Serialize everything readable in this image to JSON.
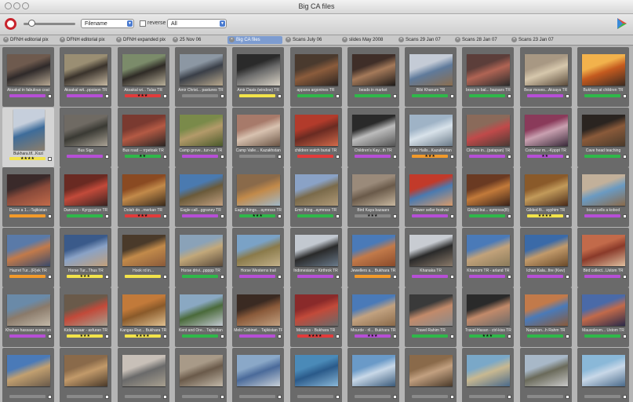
{
  "window": {
    "title": "Big CA files"
  },
  "toolbar": {
    "sort_value": "Filename",
    "reverse_label": "reverse",
    "filter_value": "All"
  },
  "tabs": [
    {
      "label": "DFNH editorial pix"
    },
    {
      "label": "DFNH editorial pix"
    },
    {
      "label": "DFNH expanded pix"
    },
    {
      "label": "25 Nov 06"
    },
    {
      "label": "Big CA files"
    },
    {
      "label": "Scans July 06"
    },
    {
      "label": "slides May 2008"
    },
    {
      "label": "Scans 29 Jan 07"
    },
    {
      "label": "Scans 28 Jan 07"
    },
    {
      "label": "Scans 23 Jan 07"
    }
  ],
  "active_tab": 4,
  "label_colors": {
    "purple": "#b64fd6",
    "green": "#2fb84a",
    "red": "#e23b3b",
    "yellow": "#f2e34a",
    "orange": "#f39a2a",
    "blue": "#4a7bd0",
    "gray": "#8a8a8a"
  },
  "rows": [
    [
      {
        "cap": "Aksakal in fabulous coat",
        "label": "purple",
        "stars": "",
        "img": [
          "#6e5a4e",
          "#2f2a2a",
          "#b7a893"
        ]
      },
      {
        "cap": "Aksakal wit...ppoison TR",
        "label": "purple",
        "stars": "",
        "img": [
          "#9a8e73",
          "#3a332c",
          "#c7b9a2"
        ]
      },
      {
        "cap": "Aksakal wi... Talas TR",
        "label": "red",
        "stars": "★★★",
        "img": [
          "#7b8b6a",
          "#2f2b26",
          "#b9b09a"
        ]
      },
      {
        "cap": "Amir Christ... pastures TR",
        "label": "gray",
        "stars": "",
        "img": [
          "#8c97a3",
          "#3a3f48",
          "#b8a88d"
        ]
      },
      {
        "cap": "Amir Dasis (window) TR",
        "label": "yellow",
        "stars": "",
        "img": [
          "#2a2a2a",
          "#6b6b6b",
          "#d7d1c4"
        ]
      },
      {
        "cap": "appana argonines TR",
        "label": "green",
        "stars": "",
        "img": [
          "#4a3a2e",
          "#8b5c3c",
          "#2c2420"
        ]
      },
      {
        "cap": "beads in market",
        "label": "green",
        "stars": "",
        "img": [
          "#3f2e28",
          "#a57a5a",
          "#1d1a18"
        ]
      },
      {
        "cap": "Bibi Khanum TR",
        "label": "green",
        "stars": "",
        "img": [
          "#c4cbd6",
          "#5f7a9b",
          "#8b6e4f"
        ]
      },
      {
        "cap": "brass in bal... bazaars TR",
        "label": "green",
        "stars": "",
        "img": [
          "#5c3e3a",
          "#b06454",
          "#2b2b2b"
        ]
      },
      {
        "cap": "Bear moves...Aksaya TR",
        "label": "purple",
        "stars": "",
        "img": [
          "#a89883",
          "#d6c7ac",
          "#5a4a3a"
        ]
      },
      {
        "cap": "Bukhara at children TR",
        "label": "green",
        "stars": "",
        "img": [
          "#f2b24c",
          "#c45a1f",
          "#3b2a20"
        ]
      }
    ],
    [
      {
        "cap": "Bukhara.tif...Kozi",
        "label": "yellow",
        "stars": "★★★★",
        "img": [
          "#c6cfdc",
          "#3e6c9a",
          "#8a7d6c"
        ],
        "sel": true
      },
      {
        "cap": "Bus Sign",
        "label": "purple",
        "stars": "",
        "img": [
          "#6f6a63",
          "#3a3a34",
          "#aaa295"
        ]
      },
      {
        "cap": "Bus road -- rrpetoak TR",
        "label": "green",
        "stars": "★★",
        "img": [
          "#7a3a30",
          "#b45a44",
          "#2a2422"
        ]
      },
      {
        "cap": "Camp grove...tun-out TR",
        "label": "purple",
        "stars": "",
        "img": [
          "#7a8a4a",
          "#b39a6a",
          "#4a5a2a"
        ]
      },
      {
        "cap": "Camp Valle... Kazakhstan",
        "label": "gray",
        "stars": "",
        "img": [
          "#a77a6a",
          "#d8c2b0",
          "#6a5444"
        ]
      },
      {
        "cap": "children watch burial TR",
        "label": "red",
        "stars": "",
        "img": [
          "#b23b2b",
          "#6a2b22",
          "#d36a4a"
        ]
      },
      {
        "cap": "Children's Kay...th TR",
        "label": "purple",
        "stars": "",
        "img": [
          "#2a2a2a",
          "#bcbcbc",
          "#555555"
        ]
      },
      {
        "cap": "Little Halls...Kazakhstan",
        "label": "orange",
        "stars": "★★★",
        "img": [
          "#9fb3c6",
          "#d8e2ea",
          "#6a7a88"
        ]
      },
      {
        "cap": "Clothes in...(patapan) TR",
        "label": "purple",
        "stars": "",
        "img": [
          "#8a6a5a",
          "#c04a4a",
          "#4a3a34"
        ]
      },
      {
        "cap": "Cochlear m...-Kpppt TR",
        "label": "purple",
        "stars": "★★",
        "img": [
          "#8a3a5a",
          "#c9a0b0",
          "#3a2a3a"
        ]
      },
      {
        "cap": "Cave head teaching",
        "label": "green",
        "stars": "",
        "img": [
          "#2a2420",
          "#8a5a3a",
          "#4a3a2a"
        ]
      }
    ],
    [
      {
        "cap": "Dome a 1...-Tajikistan",
        "label": "orange",
        "stars": "",
        "img": [
          "#3a2a2a",
          "#8a4a3a",
          "#c26a4a"
        ]
      },
      {
        "cap": "Dancers - Kyrgyzstan TR",
        "label": "green",
        "stars": "",
        "img": [
          "#6a2a22",
          "#c24a3a",
          "#3a2220"
        ]
      },
      {
        "cap": "Dolah do...merkan TR",
        "label": "red",
        "stars": "★★★",
        "img": [
          "#8a4a22",
          "#c28a4a",
          "#3a2a1a"
        ]
      },
      {
        "cap": "Eagle call...ggraney TR",
        "label": "purple",
        "stars": "",
        "img": [
          "#4a7ab0",
          "#6a5a3a",
          "#c2a080"
        ]
      },
      {
        "cap": "Eagle things... aymrsss TR",
        "label": "green",
        "stars": "★★★",
        "img": [
          "#8a6a4a",
          "#c28a4a",
          "#a0b8c8"
        ]
      },
      {
        "cap": "Emir thing...aymrsss TR",
        "label": "green",
        "stars": "",
        "img": [
          "#8aa2c6",
          "#7a6a4a",
          "#b09a78"
        ]
      },
      {
        "cap": "Bird Kaya bazaars",
        "label": "gray",
        "stars": "★★★",
        "img": [
          "#9a8a7a",
          "#6a5a4a",
          "#c8b8a0"
        ]
      },
      {
        "cap": "Flower seller festival",
        "label": "purple",
        "stars": "",
        "img": [
          "#c23a2a",
          "#4a7ab0",
          "#d89a6a"
        ]
      },
      {
        "cap": "Gilded bui... aymrsss(B)",
        "label": "green",
        "stars": "",
        "img": [
          "#6a3a22",
          "#c27a3a",
          "#3a2218"
        ]
      },
      {
        "cap": "Gilded fli... ayphim TR",
        "label": "yellow",
        "stars": "★★★★",
        "img": [
          "#8a5a2a",
          "#c29a5a",
          "#4a2a18"
        ]
      },
      {
        "cap": "bicus cells a kobod",
        "label": "purple",
        "stars": "",
        "img": [
          "#c2b09a",
          "#6a9ac2",
          "#8a6a4a"
        ]
      }
    ],
    [
      {
        "cap": "Hazret Tur...(R)ek TR",
        "label": "orange",
        "stars": "",
        "img": [
          "#5a7aa8",
          "#c27a4a",
          "#3a4a6a"
        ]
      },
      {
        "cap": "Horse Tur...Thus TR",
        "label": "yellow",
        "stars": "★★★",
        "img": [
          "#3a5a8a",
          "#8aa2c6",
          "#c2a07a"
        ]
      },
      {
        "cap": "Hook rd in...",
        "label": "yellow",
        "stars": "",
        "img": [
          "#4a3a2a",
          "#c28a4a",
          "#8a5a3a"
        ]
      },
      {
        "cap": "Horse drivi...ppppp TR",
        "label": "green",
        "stars": "",
        "img": [
          "#8aa2b8",
          "#c2a87a",
          "#5a4a3a"
        ]
      },
      {
        "cap": "Horse Westerns trail",
        "label": "purple",
        "stars": "",
        "img": [
          "#7aa2c6",
          "#8a7a4a",
          "#c2b08a"
        ]
      },
      {
        "cap": "Indonesians - Kirthrok TR",
        "label": "purple",
        "stars": "",
        "img": [
          "#c2c8d0",
          "#2a2a2a",
          "#6a7a8a"
        ]
      },
      {
        "cap": "Jewellers a... Bukhara TR",
        "label": "orange",
        "stars": "",
        "img": [
          "#4a7ab8",
          "#c27a4a",
          "#8a4a2a"
        ]
      },
      {
        "cap": "Khanaka TR",
        "label": "purple",
        "stars": "",
        "img": [
          "#c8ccd2",
          "#2a2a2a",
          "#8a7a6a"
        ]
      },
      {
        "cap": "Kharezm TR - arland TR",
        "label": "purple",
        "stars": "",
        "img": [
          "#4a7ab8",
          "#c2a27a",
          "#8a7a5a"
        ]
      },
      {
        "cap": "Ichan Kala...fire (Kiev)",
        "label": "purple",
        "stars": "",
        "img": [
          "#3a6aa8",
          "#c29a6a",
          "#6a4a2a"
        ]
      },
      {
        "cap": "Bird collect...Ustom TR",
        "label": "purple",
        "stars": "",
        "img": [
          "#c26a4a",
          "#8a3a2a",
          "#e0c0a0"
        ]
      }
    ],
    [
      {
        "cap": "Khahan hassaar scene on",
        "label": "purple",
        "stars": "",
        "img": [
          "#6a8aa8",
          "#8a7a6a",
          "#c2b8a8"
        ]
      },
      {
        "cap": "Kids bazaar - asfuran TR",
        "label": "yellow",
        "stars": "★★★",
        "img": [
          "#6a5a4a",
          "#c24a3a",
          "#a8a090"
        ]
      },
      {
        "cap": "Kangas Ruz... Bukhara TR",
        "label": "yellow",
        "stars": "★★★★",
        "img": [
          "#c27a3a",
          "#8a5a2a",
          "#e0c090"
        ]
      },
      {
        "cap": "Kent and Ore... Tajikistan",
        "label": "green",
        "stars": "",
        "img": [
          "#8aa8c2",
          "#4a6a3a",
          "#c2c8d0"
        ]
      },
      {
        "cap": "Melo Cabinet... Tajikistan TR",
        "label": "purple",
        "stars": "",
        "img": [
          "#3a2a22",
          "#8a5a3a",
          "#c2a080"
        ]
      },
      {
        "cap": "Mosaics - Bukhara TR",
        "label": "red",
        "stars": "★★★★",
        "img": [
          "#8a2a2a",
          "#c24a3a",
          "#6a6a6a"
        ]
      },
      {
        "cap": "Mourde - rll... Bukhara TR",
        "label": "purple",
        "stars": "★★★",
        "img": [
          "#4a7ab8",
          "#c2a280",
          "#8a6a4a"
        ]
      },
      {
        "cap": "Travel Rahim TR",
        "label": "green",
        "stars": "",
        "img": [
          "#3a3a3a",
          "#c28a6a",
          "#8a8a8a"
        ]
      },
      {
        "cap": "Travel Hasan - ctrl-kiss TR",
        "label": "green",
        "stars": "★★★",
        "img": [
          "#2a2a2a",
          "#c28a6a",
          "#6a6a6a"
        ]
      },
      {
        "cap": "Naqsban...h Rahm TR",
        "label": "green",
        "stars": "",
        "img": [
          "#c27a4a",
          "#4a7ab8",
          "#8a5a3a"
        ]
      },
      {
        "cap": "Mausoleum... Ustom TR",
        "label": "green",
        "stars": "",
        "img": [
          "#4a6aa8",
          "#c26a4a",
          "#2a2a4a"
        ]
      }
    ],
    [
      {
        "cap": "",
        "label": "gray",
        "stars": "",
        "img": [
          "#4a7ab8",
          "#c2a070",
          "#6a5a4a"
        ]
      },
      {
        "cap": "",
        "label": "gray",
        "stars": "",
        "img": [
          "#8a6a4a",
          "#c29a6a",
          "#4a3a2a"
        ]
      },
      {
        "cap": "",
        "label": "gray",
        "stars": "",
        "img": [
          "#c8c0b8",
          "#6a6a6a",
          "#a8a090"
        ]
      },
      {
        "cap": "",
        "label": "gray",
        "stars": "",
        "img": [
          "#a89a88",
          "#6a5a4a",
          "#c2b8a8"
        ]
      },
      {
        "cap": "",
        "label": "gray",
        "stars": "",
        "img": [
          "#8aa8c8",
          "#4a6a9a",
          "#c8d0d8"
        ]
      },
      {
        "cap": "",
        "label": "gray",
        "stars": "",
        "img": [
          "#4a8ab8",
          "#2a5a8a",
          "#8ab8d8"
        ]
      },
      {
        "cap": "",
        "label": "gray",
        "stars": "",
        "img": [
          "#6a9ac8",
          "#c8d8e8",
          "#3a5a7a"
        ]
      },
      {
        "cap": "",
        "label": "gray",
        "stars": "",
        "img": [
          "#8a6a4a",
          "#c2a080",
          "#4a3a2a"
        ]
      },
      {
        "cap": "",
        "label": "gray",
        "stars": "",
        "img": [
          "#7aa8c8",
          "#c8b890",
          "#4a6a8a"
        ]
      },
      {
        "cap": "",
        "label": "gray",
        "stars": "",
        "img": [
          "#a8b8c8",
          "#6a6a5a",
          "#c8c8c8"
        ]
      },
      {
        "cap": "",
        "label": "gray",
        "stars": "",
        "img": [
          "#8ab8d8",
          "#c8d8e8",
          "#4a6a8a"
        ]
      }
    ]
  ]
}
